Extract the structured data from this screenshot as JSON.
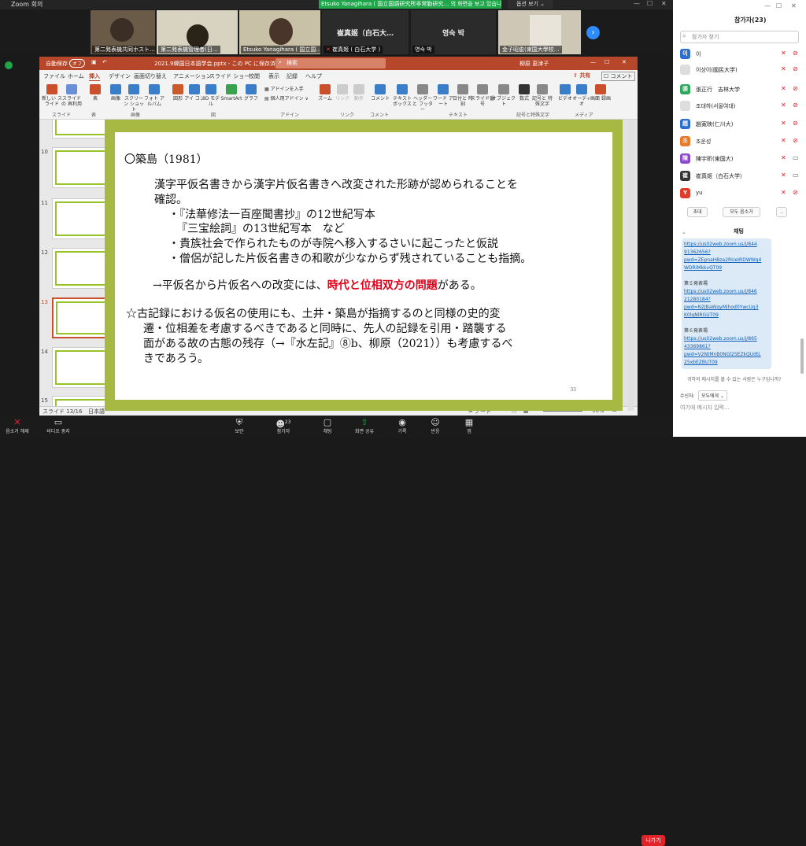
{
  "zoom": {
    "title": "Zoom 회의",
    "share_banner": "Etsuko Yanagihara ( 国立国語研究所非常勤研究… 의 화면을 보고 있습니다.",
    "view_options": "옵션 보기 ⌄"
  },
  "tiles": [
    {
      "label": "第二発表機共同ホスト…",
      "name": ""
    },
    {
      "label": "第二発表機管理者(日…",
      "name": ""
    },
    {
      "label": "Etsuko Yanagihara ( 国立国…",
      "name": ""
    },
    {
      "label": "崔真姬 ( 白石大学 )",
      "name": "崔真姬（白石大…"
    },
    {
      "label": "영숙 박",
      "name": "영숙 박"
    },
    {
      "label": "金子昭俊(東国大學校…",
      "name": ""
    }
  ],
  "ppt": {
    "autosave": "自動保存",
    "autosave_state": "オフ",
    "filename": "2021.9韓国日本語学会.pptx - この PC に保存済み ∨",
    "search": "検索",
    "user": "柳原 恵津子",
    "menu": [
      "ファイル",
      "ホーム",
      "挿入",
      "デザイン",
      "画面切り替え",
      "アニメーション",
      "スライド ショー",
      "校閲",
      "表示",
      "記録",
      "ヘルプ"
    ],
    "share": "共有",
    "comment": "コメント",
    "ribbon": [
      {
        "label": "新しい スライド",
        "color": "#c9502a"
      },
      {
        "label": "スライドの 再利用",
        "color": "#6b8fd6"
      },
      {
        "label": "表",
        "color": "#c9502a"
      },
      {
        "label": "画像",
        "color": "#3a7dc9"
      },
      {
        "label": "スクリーン ショット",
        "color": "#3a7dc9"
      },
      {
        "label": "フォト アルバム",
        "color": "#3a7dc9"
      },
      {
        "label": "図形",
        "color": "#c95a2a"
      },
      {
        "label": "アイ コン",
        "color": "#3a7dc9"
      },
      {
        "label": "3D モデル",
        "color": "#3a7dc9"
      },
      {
        "label": "SmartArt",
        "color": "#3aa14f"
      },
      {
        "label": "グラフ",
        "color": "#3a7dc9"
      },
      {
        "label": "ズーム",
        "color": "#c9502a"
      },
      {
        "label": "リンク",
        "color": "#aaa"
      },
      {
        "label": "動作",
        "color": "#aaa"
      },
      {
        "label": "コメント",
        "color": "#3a7dc9"
      },
      {
        "label": "テキスト ボックス",
        "color": "#3a7dc9"
      },
      {
        "label": "ヘッダーと フッター",
        "color": "#888"
      },
      {
        "label": "ワード アート",
        "color": "#3a7dc9"
      },
      {
        "label": "日付と 時刻",
        "color": "#888"
      },
      {
        "label": "スライド番号",
        "color": "#888"
      },
      {
        "label": "オブジェクト",
        "color": "#888"
      },
      {
        "label": "数式",
        "color": "#333"
      },
      {
        "label": "記号と 特殊文字",
        "color": "#888"
      },
      {
        "label": "ビデオ",
        "color": "#3a7dc9"
      },
      {
        "label": "オーディオ",
        "color": "#3a7dc9"
      },
      {
        "label": "画面 録画",
        "color": "#c9502a"
      }
    ],
    "addin1": "アドインを入手",
    "addin2": "個人用アドイン ∨",
    "groups": [
      "スライド",
      "表",
      "画像",
      "図",
      "アドイン",
      "リンク",
      "コメント",
      "テキスト",
      "記号と特殊文字",
      "メディア"
    ],
    "thumb_numbers": [
      "10",
      "11",
      "12",
      "13",
      "14",
      "15"
    ],
    "status_slide": "スライド 13/16",
    "status_lang": "日本語",
    "status_note": "ノート",
    "status_zoom": "96%"
  },
  "slide": {
    "lines": [
      "〇築島（1981）",
      "漢字平仮名書きから漢字片仮名書きへ改変された形跡が認められることを",
      "確認。",
      "・『法華修法一百座聞書抄』の12世紀写本",
      "『三宝絵詞』の13世紀写本　など",
      "・貴族社会で作られたものが寺院へ移入するさいに起こったと仮説",
      "・僧侶が記した片仮名書きの和歌が少なからず残されていることも指摘。"
    ],
    "arrow_prefix": "→平仮名から片仮名への改変には、",
    "arrow_red": "時代と位相双方の問題",
    "arrow_suffix": "がある。",
    "star": [
      "☆古記録における仮名の使用にも、土井・築島が指摘するのと同様の史的変",
      "遷・位相差を考慮するべきであると同時に、先人の記録を引用・踏襲する",
      "面がある故の古態の残存（→『水左記』⑧b、柳原（2021））も考慮するべ",
      "きであろう。"
    ],
    "page": "33"
  },
  "sidebar": {
    "title": "참가자(23)",
    "search": "참가자 찾기",
    "participants": [
      {
        "initial": "이",
        "name": "이",
        "color": "#2d6fd1"
      },
      {
        "initial": "",
        "name": "이상이(國民大学)",
        "color": "#dddddd"
      },
      {
        "initial": "張",
        "name": "張正行　吉林大学",
        "color": "#2ea85a"
      },
      {
        "initial": "",
        "name": "조대하(서울여대)",
        "color": "#dddddd"
      },
      {
        "initial": "趙",
        "name": "趙寛映(仁川大)",
        "color": "#2d6fd1"
      },
      {
        "initial": "조",
        "name": "조운성",
        "color": "#e87a2a"
      },
      {
        "initial": "陳",
        "name": "陳宇昕(東国大)",
        "color": "#8a4bc9"
      },
      {
        "initial": "崔",
        "name": "崔真姬（白石大学）",
        "color": "#333333"
      },
      {
        "initial": "Y",
        "name": "yu",
        "color": "#e03c2a"
      }
    ],
    "invite": "초대",
    "mute_all": "모두 음소거",
    "more": "..",
    "chat_title": "채팅",
    "chat_lines": [
      {
        "t": "https://us02web.zoom.us/j/844",
        "l": true
      },
      {
        "t": "91362656?",
        "l": true
      },
      {
        "t": "pwd=ZEpnaHBza2RUeIRDWWg4",
        "l": true
      },
      {
        "t": "WDRiMkkvQT09",
        "l": true
      },
      {
        "t": "",
        "l": false
      },
      {
        "t": "第５発表場",
        "l": false
      },
      {
        "t": "https://us02web.zoom.us/j/846",
        "l": true
      },
      {
        "t": "21280184?",
        "l": true
      },
      {
        "t": "pwd=N2JBaWgyMjhod0YwcUg3",
        "l": true
      },
      {
        "t": "K0lqNlRGUT09",
        "l": true
      },
      {
        "t": "",
        "l": false
      },
      {
        "t": "第６発表場",
        "l": false
      },
      {
        "t": "https://us02web.zoom.us/j/865",
        "l": true
      },
      {
        "t": "43369861?",
        "l": true
      },
      {
        "t": "pwd=V2NtMnB0NGl2SEZkQUdtL",
        "l": true
      },
      {
        "t": "25xbEZBUT09",
        "l": true
      }
    ],
    "who_note": "귀하의 메시지를 볼 수 있는 사람은 누구입니까?",
    "recipient_label": "수신자:",
    "recipient": "모두에게 ⌄",
    "message_placeholder": "여기에 메시지 입력..."
  },
  "controls": {
    "mute": "음소거 해제",
    "video": "비디오 중지",
    "security": "보안",
    "participants": "참가자",
    "participants_count": "23",
    "chat": "채팅",
    "share": "화면 공유",
    "record": "기록",
    "reactions": "반응",
    "apps": "앱",
    "leave": "나가기"
  }
}
